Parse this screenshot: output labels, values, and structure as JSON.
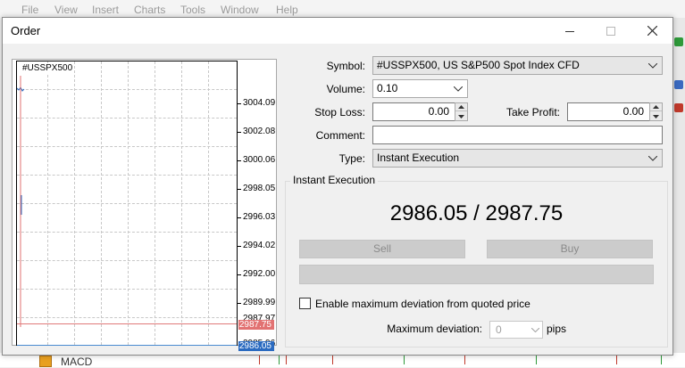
{
  "background_app": {
    "menu": [
      "File",
      "View",
      "Insert",
      "Charts",
      "Tools",
      "Window",
      "Help"
    ],
    "indicator_label": "MACD"
  },
  "dialog": {
    "title": "Order"
  },
  "chart": {
    "symbol": "#USSPX500",
    "price_ticks": [
      "3004.09",
      "3002.08",
      "3000.06",
      "2998.05",
      "2996.03",
      "2994.02",
      "2992.00",
      "2989.99",
      "2987.97",
      "2985.96"
    ],
    "ask_price": "2987.75",
    "bid_price": "2986.05",
    "ask_color": "#e27272",
    "bid_color": "#2a6ac0"
  },
  "form": {
    "symbol_label": "Symbol:",
    "symbol_value": "#USSPX500, US S&P500 Spot Index CFD",
    "volume_label": "Volume:",
    "volume_value": "0.10",
    "stop_loss_label": "Stop Loss:",
    "stop_loss_value": "0.00",
    "take_profit_label": "Take Profit:",
    "take_profit_value": "0.00",
    "comment_label": "Comment:",
    "comment_value": "",
    "type_label": "Type:",
    "type_value": "Instant Execution"
  },
  "execution": {
    "group_title": "Instant Execution",
    "quote": "2986.05 / 2987.75",
    "sell_label": "Sell",
    "buy_label": "Buy",
    "max_dev_checkbox_label": "Enable maximum deviation from quoted price",
    "max_dev_label": "Maximum deviation:",
    "max_dev_value": "0",
    "max_dev_unit": "pips"
  }
}
